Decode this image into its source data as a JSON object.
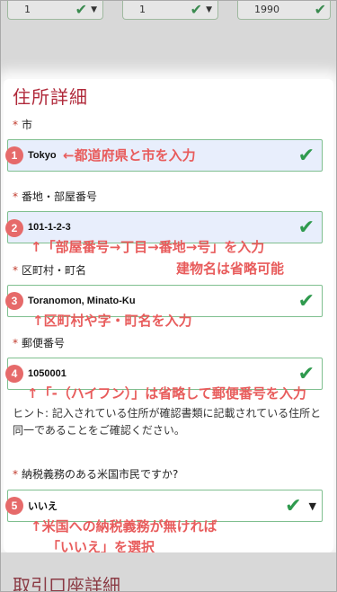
{
  "top_selects": [
    {
      "value": "1"
    },
    {
      "value": "1"
    },
    {
      "value": "1990"
    }
  ],
  "section_title": "住所詳細",
  "required_mark": "*",
  "fields": {
    "city": {
      "label": "市",
      "value": "Tokyo",
      "badge": "1",
      "annotation": "←都道府県と市を入力"
    },
    "address": {
      "label": "番地・部屋番号",
      "value": "101-1-2-3",
      "badge": "2",
      "annotation_line1": "↑「部屋番号→丁目→番地→号」を入力",
      "annotation_line2": "建物名は省略可能"
    },
    "district": {
      "label": "区町村・町名",
      "value": "Toranomon, Minato-Ku",
      "badge": "3",
      "annotation": "↑区町村や字・町名を入力"
    },
    "postal": {
      "label": "郵便番号",
      "value": "1050001",
      "badge": "4",
      "annotation": "↑「-（ハイフン）」は省略して郵便番号を入力"
    },
    "us_tax": {
      "label": "納税義務のある米国市民ですか?",
      "value": "いいえ",
      "badge": "5",
      "annotation_line1": "↑米国への納税義務が無ければ",
      "annotation_line2": "「いいえ」を選択"
    }
  },
  "hint_text": "ヒント: 記入されている住所が確認書類に記載されている住所と同一であることをご確認ください。",
  "next_section_title": "取引口座詳細",
  "icons": {
    "check": "check-icon",
    "caret": "chevron-down-icon"
  },
  "colors": {
    "title": "#b0293a",
    "annotation": "#e85c5c",
    "badge": "#e66a6a",
    "check": "#2f9a4e",
    "input_border": "#7fbf8f"
  }
}
